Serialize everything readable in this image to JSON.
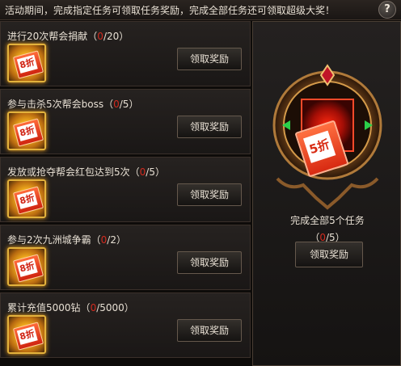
{
  "header": {
    "text": "活动期间，完成指定任务可领取任务奖励，完成全部任务还可领取超级大奖！",
    "help": "?"
  },
  "tasks": [
    {
      "prefix": "进行20次帮会捐献",
      "open": "（",
      "current": "0",
      "total": "/20",
      "close": "）",
      "badge": "8折",
      "button": "领取奖励"
    },
    {
      "prefix": "参与击杀5次帮会boss",
      "open": "（",
      "current": "0",
      "total": "/5",
      "close": "）",
      "badge": "8折",
      "button": "领取奖励"
    },
    {
      "prefix": "发放或抢夺帮会红包达到5次",
      "open": "（",
      "current": "0",
      "total": "/5",
      "close": "）",
      "badge": "8折",
      "button": "领取奖励"
    },
    {
      "prefix": "参与2次九洲城争霸",
      "open": "（",
      "current": "0",
      "total": "/2",
      "close": "）",
      "badge": "8折",
      "button": "领取奖励"
    },
    {
      "prefix": "累计充值5000钻",
      "open": "（",
      "current": "0",
      "total": "/5000",
      "close": "）",
      "badge": "8折",
      "button": "领取奖励"
    }
  ],
  "grand": {
    "badge": "5折",
    "title": "完成全部5个任务",
    "open": "（",
    "current": "0",
    "total": "/5",
    "close": "）",
    "button": "领取奖励"
  }
}
